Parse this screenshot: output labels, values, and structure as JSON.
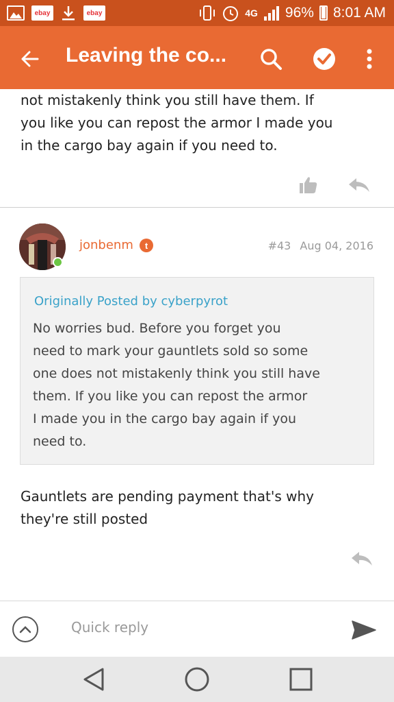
{
  "status_bar": {
    "notif_ebay_1": "ebay",
    "notif_ebay_2": "ebay",
    "network": "4G",
    "battery": "96%",
    "time": "8:01 AM"
  },
  "app_bar": {
    "title": "Leaving the co..."
  },
  "posts": {
    "previous": {
      "text_lines": [
        "not mistakenly think you still have them. If",
        "you like you can repost the armor I made you",
        "in the cargo bay again if you need to."
      ]
    },
    "current": {
      "username": "jonbenm",
      "badge": "t",
      "number": "#43",
      "date": "Aug 04, 2016",
      "quote": {
        "header": "Originally Posted by cyberpyrot",
        "lines": [
          "No worries bud. Before you forget you",
          "need to mark your gauntlets sold so some",
          "one does not mistakenly think you still have",
          "them. If you like you can repost the armor",
          "I made you in the cargo bay again if you",
          "need to."
        ]
      },
      "text_lines": [
        "Gauntlets are pending payment that's why",
        "they're still posted"
      ]
    }
  },
  "quick_reply": {
    "placeholder": "Quick reply"
  },
  "colors": {
    "status_bar": "#c9511d",
    "app_bar": "#e96a33",
    "username": "#e96a33",
    "quote_header": "#3aa2c9",
    "online": "#6cc644"
  }
}
